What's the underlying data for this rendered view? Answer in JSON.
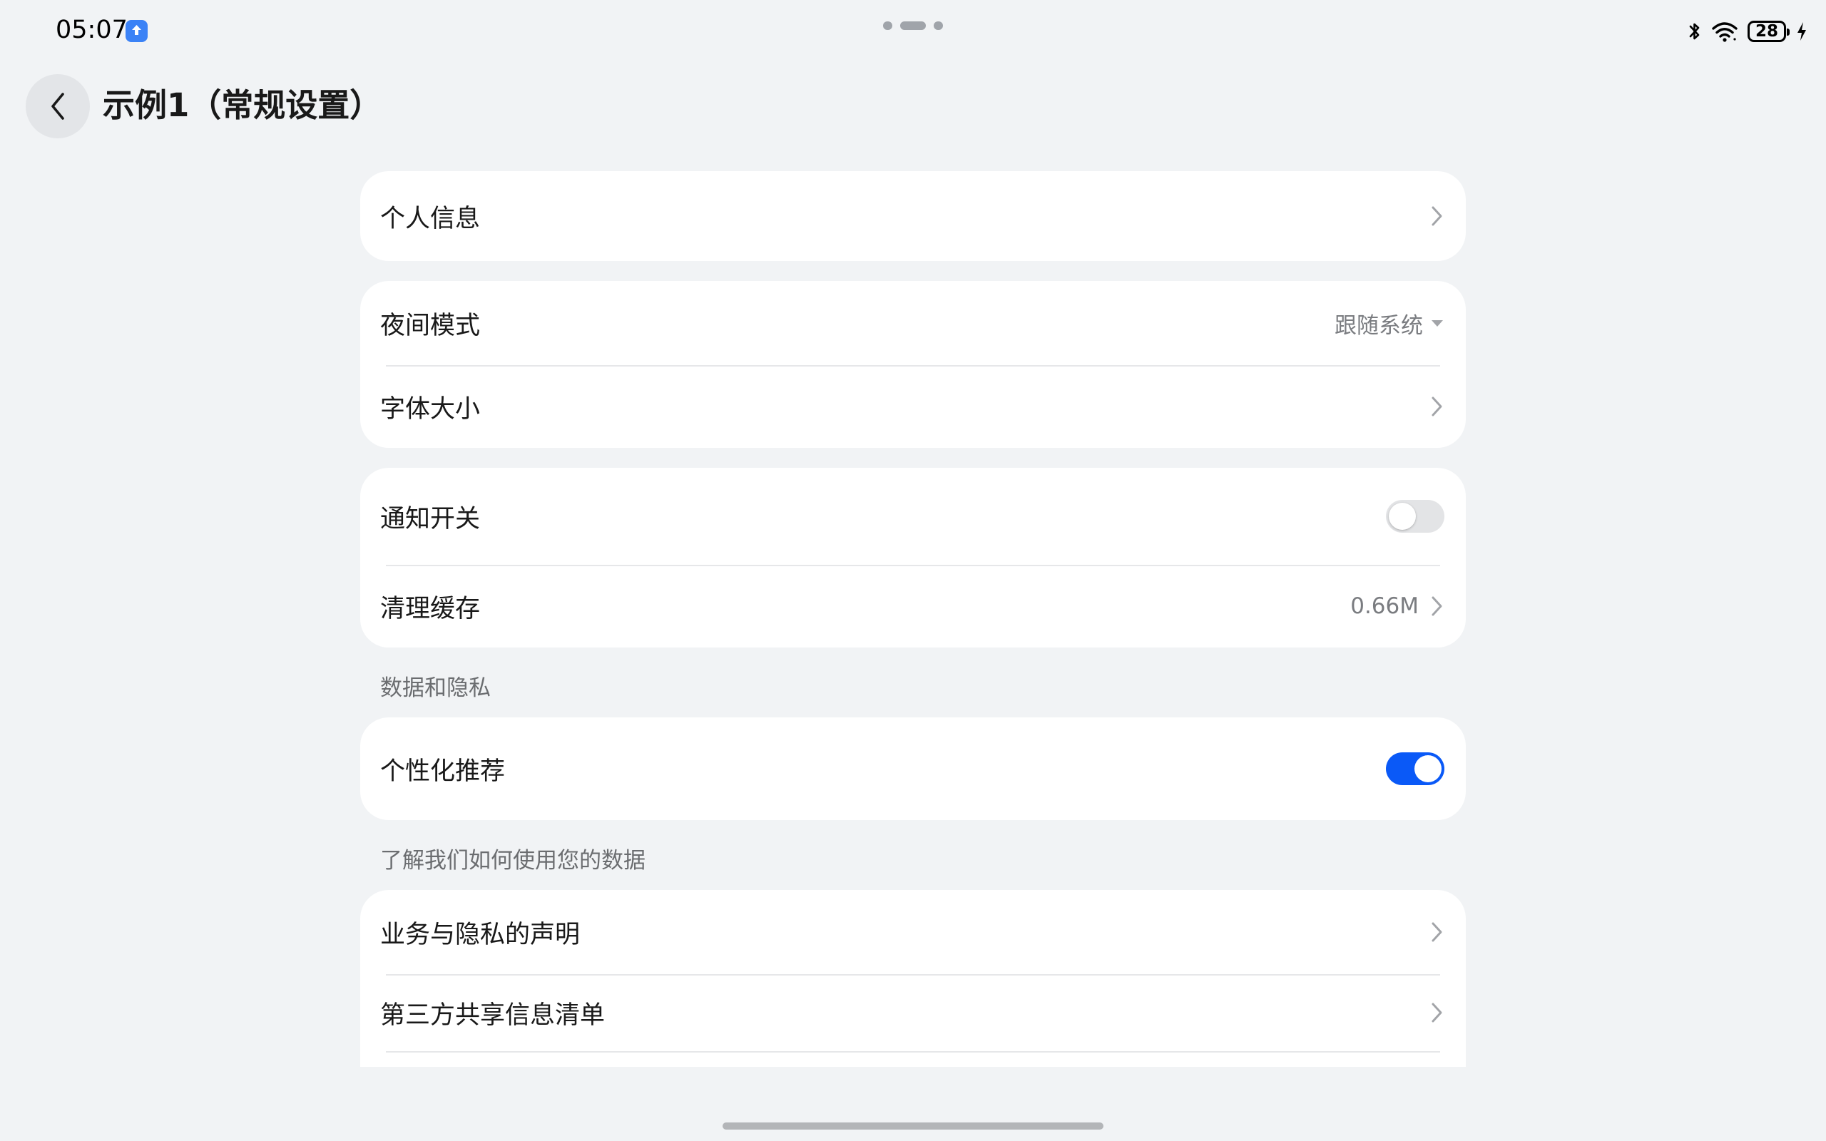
{
  "status_bar": {
    "time": "05:07",
    "battery_level": "28",
    "icons": [
      "bluetooth-icon",
      "wifi-icon",
      "battery-icon",
      "charging-icon"
    ]
  },
  "header": {
    "title": "示例1（常规设置）",
    "back_icon": "chevron-left-icon"
  },
  "groups": [
    {
      "items": [
        {
          "label": "个人信息",
          "type": "link"
        }
      ]
    },
    {
      "items": [
        {
          "label": "夜间模式",
          "type": "select",
          "value": "跟随系统"
        },
        {
          "label": "字体大小",
          "type": "link"
        }
      ]
    },
    {
      "items": [
        {
          "label": "通知开关",
          "type": "toggle",
          "on": false
        },
        {
          "label": "清理缓存",
          "type": "link",
          "value": "0.66M"
        }
      ]
    },
    {
      "section_title": "数据和隐私",
      "items": [
        {
          "label": "个性化推荐",
          "type": "toggle",
          "on": true
        }
      ]
    },
    {
      "section_title": "了解我们如何使用您的数据",
      "items": [
        {
          "label": "业务与隐私的声明",
          "type": "link"
        },
        {
          "label": "第三方共享信息清单",
          "type": "link"
        }
      ]
    }
  ],
  "colors": {
    "accent": "#0a59f7",
    "background": "#f1f3f5",
    "card": "#ffffff"
  }
}
